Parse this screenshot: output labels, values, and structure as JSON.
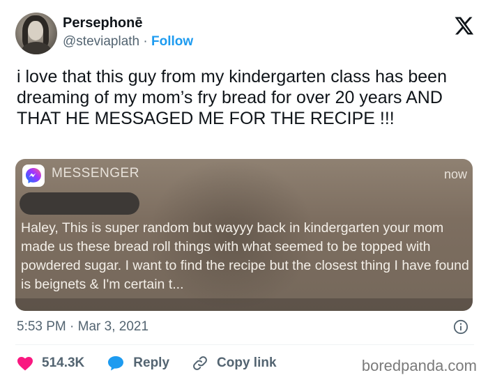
{
  "author": {
    "name": "Persephonē",
    "handle": "@steviaplath",
    "separator": "·",
    "follow_label": "Follow"
  },
  "tweet": {
    "text": "i love that this guy from my kindergarten class has been dreaming of my mom’s fry bread for over 20 years AND THAT HE MESSAGED ME FOR THE RECIPE !!!"
  },
  "notification": {
    "app": "MESSENGER",
    "time": "now",
    "body": "Haley, This is super random but wayyy back in kindergarten your mom made us these bread roll things with what seemed to be topped with powdered sugar. I want to find the recipe but the closest thing I have found is beignets & I'm certain t..."
  },
  "meta": {
    "timestamp": "5:53 PM · Mar 3, 2021"
  },
  "actions": {
    "likes": "514.3K",
    "reply_label": "Reply",
    "copy_link_label": "Copy link"
  },
  "watermark": "boredpanda.com",
  "colors": {
    "link": "#1d9bf0",
    "heart": "#f91880",
    "muted": "#536471"
  },
  "icons": [
    "x-logo-icon",
    "messenger-icon",
    "info-icon",
    "heart-icon",
    "reply-bubble-icon",
    "link-icon"
  ]
}
